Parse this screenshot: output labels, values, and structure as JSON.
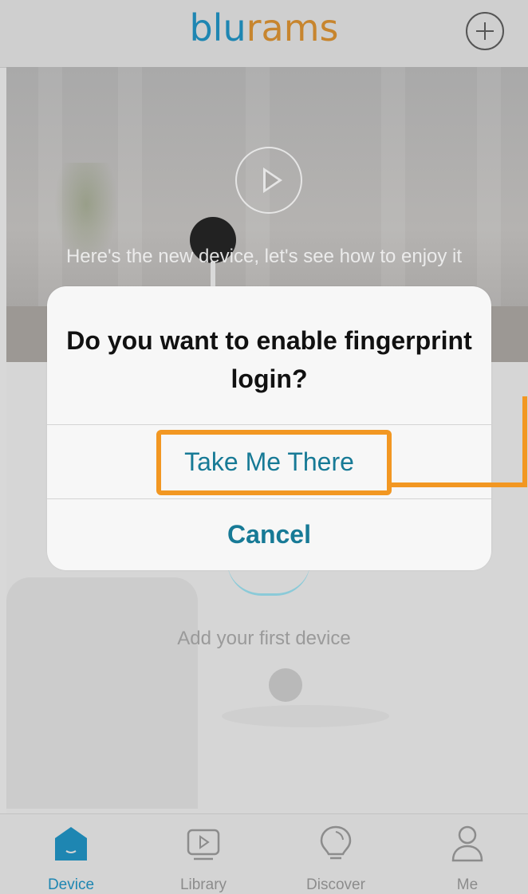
{
  "header": {
    "logo_part1": "blu",
    "logo_part2": "rams",
    "add_button_icon": "plus-circle-icon"
  },
  "hero": {
    "caption": "Here's the new device, let's see how to enjoy it",
    "play_icon": "play-icon"
  },
  "empty_state": {
    "text": "Add your first device"
  },
  "dialog": {
    "title": "Do you want to enable fingerprint login?",
    "primary_button": "Take Me There",
    "cancel_button": "Cancel"
  },
  "tabbar": {
    "tabs": [
      {
        "label": "Device",
        "icon": "home-icon",
        "active": true
      },
      {
        "label": "Library",
        "icon": "library-play-icon",
        "active": false
      },
      {
        "label": "Discover",
        "icon": "lightbulb-icon",
        "active": false
      },
      {
        "label": "Me",
        "icon": "user-icon",
        "active": false
      }
    ]
  },
  "colors": {
    "brand_blue": "#1e86b2",
    "brand_orange": "#c7852e",
    "dialog_button": "#177a96",
    "highlight": "#f29722"
  }
}
